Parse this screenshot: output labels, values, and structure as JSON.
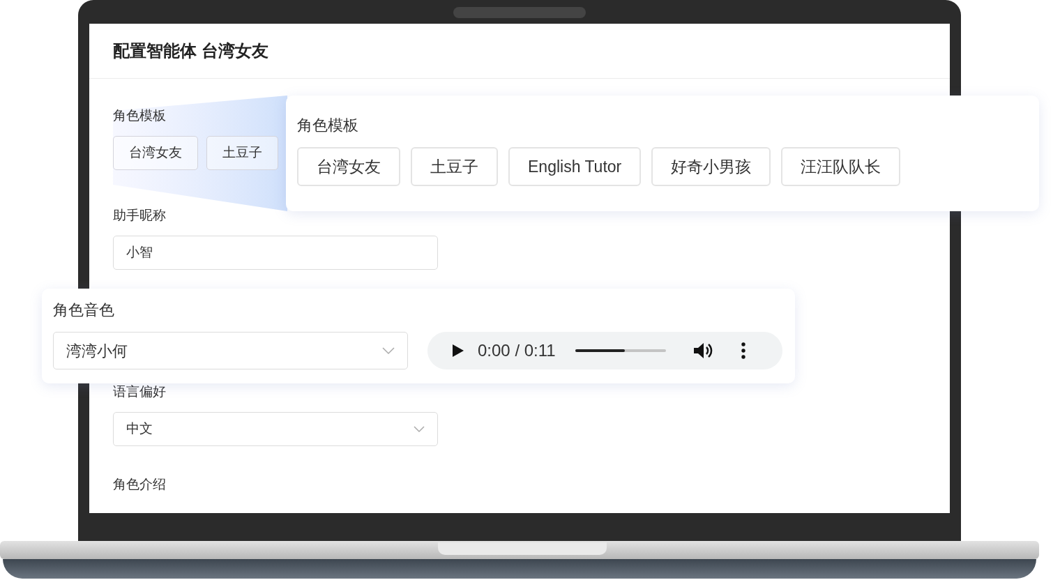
{
  "title": "配置智能体 台湾女友",
  "screen": {
    "template_label": "角色模板",
    "templates": [
      "台湾女友",
      "土豆子"
    ],
    "nickname_label": "助手昵称",
    "nickname_value": "小智",
    "language_label": "语言偏好",
    "language_value": "中文",
    "intro_label": "角色介绍"
  },
  "template_callout": {
    "label": "角色模板",
    "templates": [
      "台湾女友",
      "土豆子",
      "English Tutor",
      "好奇小男孩",
      "汪汪队队长"
    ]
  },
  "voice_callout": {
    "label": "角色音色",
    "voice_value": "湾湾小何",
    "player": {
      "time": "0:00 / 0:11",
      "level": 0.55
    }
  }
}
